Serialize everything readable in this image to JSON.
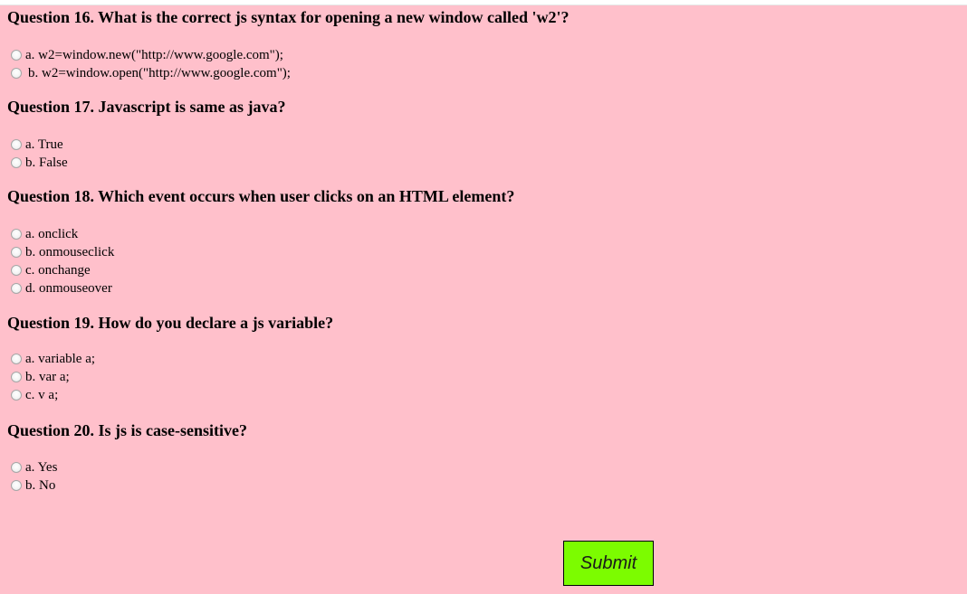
{
  "colors": {
    "page_background": "#ffc0cb",
    "submit_background": "#7cfc00"
  },
  "questions": [
    {
      "title": "Question 16. What is the correct js syntax for opening a new window called 'w2'?",
      "options": [
        "a. w2=window.new(\"http://www.google.com\");",
        "b. w2=window.open(\"http://www.google.com\");"
      ]
    },
    {
      "title": "Question 17. Javascript is same as java?",
      "options": [
        "a. True",
        "b. False"
      ]
    },
    {
      "title": "Question 18. Which event occurs when user clicks on an HTML element?",
      "options": [
        "a. onclick",
        "b. onmouseclick",
        "c. onchange",
        "d. onmouseover"
      ]
    },
    {
      "title": "Question 19. How do you declare a js variable?",
      "options": [
        "a. variable a;",
        "b. var a;",
        "c. v a;"
      ]
    },
    {
      "title": "Question 20. Is js is case-sensitive?",
      "options": [
        "a. Yes",
        "b. No"
      ]
    }
  ],
  "submit": {
    "label": "Submit"
  }
}
